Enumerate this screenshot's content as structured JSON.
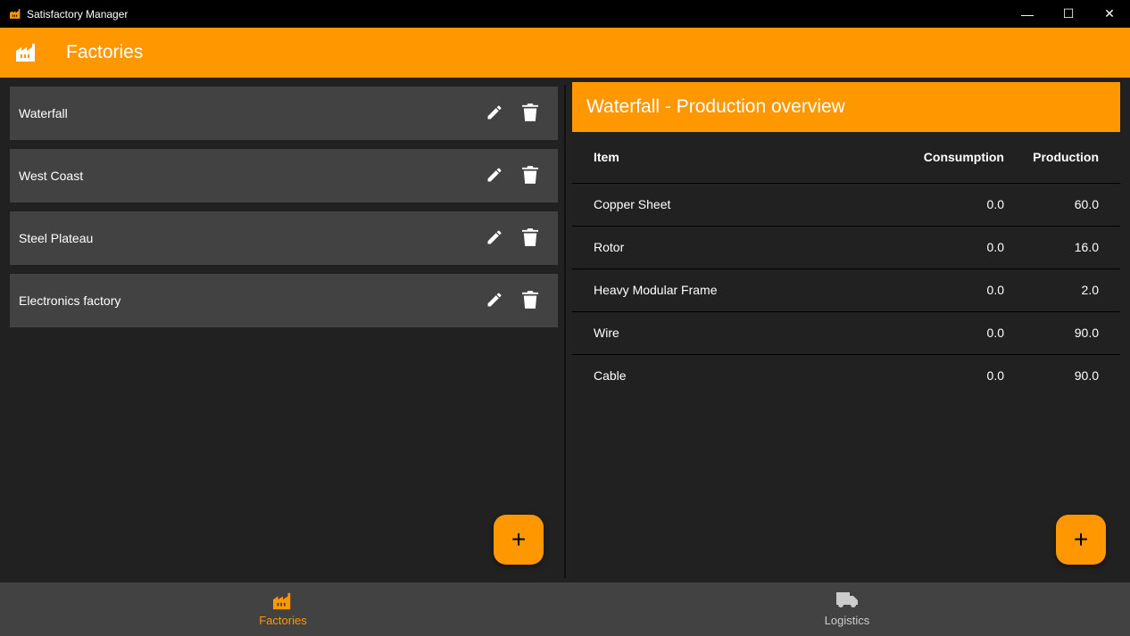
{
  "window": {
    "title": "Satisfactory Manager"
  },
  "appbar": {
    "title": "Factories"
  },
  "factories": [
    {
      "name": "Waterfall"
    },
    {
      "name": "West Coast"
    },
    {
      "name": "Steel Plateau"
    },
    {
      "name": "Electronics factory"
    }
  ],
  "overview": {
    "title": "Waterfall - Production overview",
    "columns": [
      "Item",
      "Consumption",
      "Production"
    ],
    "rows": [
      [
        "Copper Sheet",
        "0.0",
        "60.0"
      ],
      [
        "Rotor",
        "0.0",
        "16.0"
      ],
      [
        "Heavy Modular Frame",
        "0.0",
        "2.0"
      ],
      [
        "Wire",
        "0.0",
        "90.0"
      ],
      [
        "Cable",
        "0.0",
        "90.0"
      ]
    ]
  },
  "nav": {
    "factories": "Factories",
    "logistics": "Logistics"
  },
  "colors": {
    "accent": "#ff9800",
    "card": "#424242",
    "bg": "#212121"
  }
}
